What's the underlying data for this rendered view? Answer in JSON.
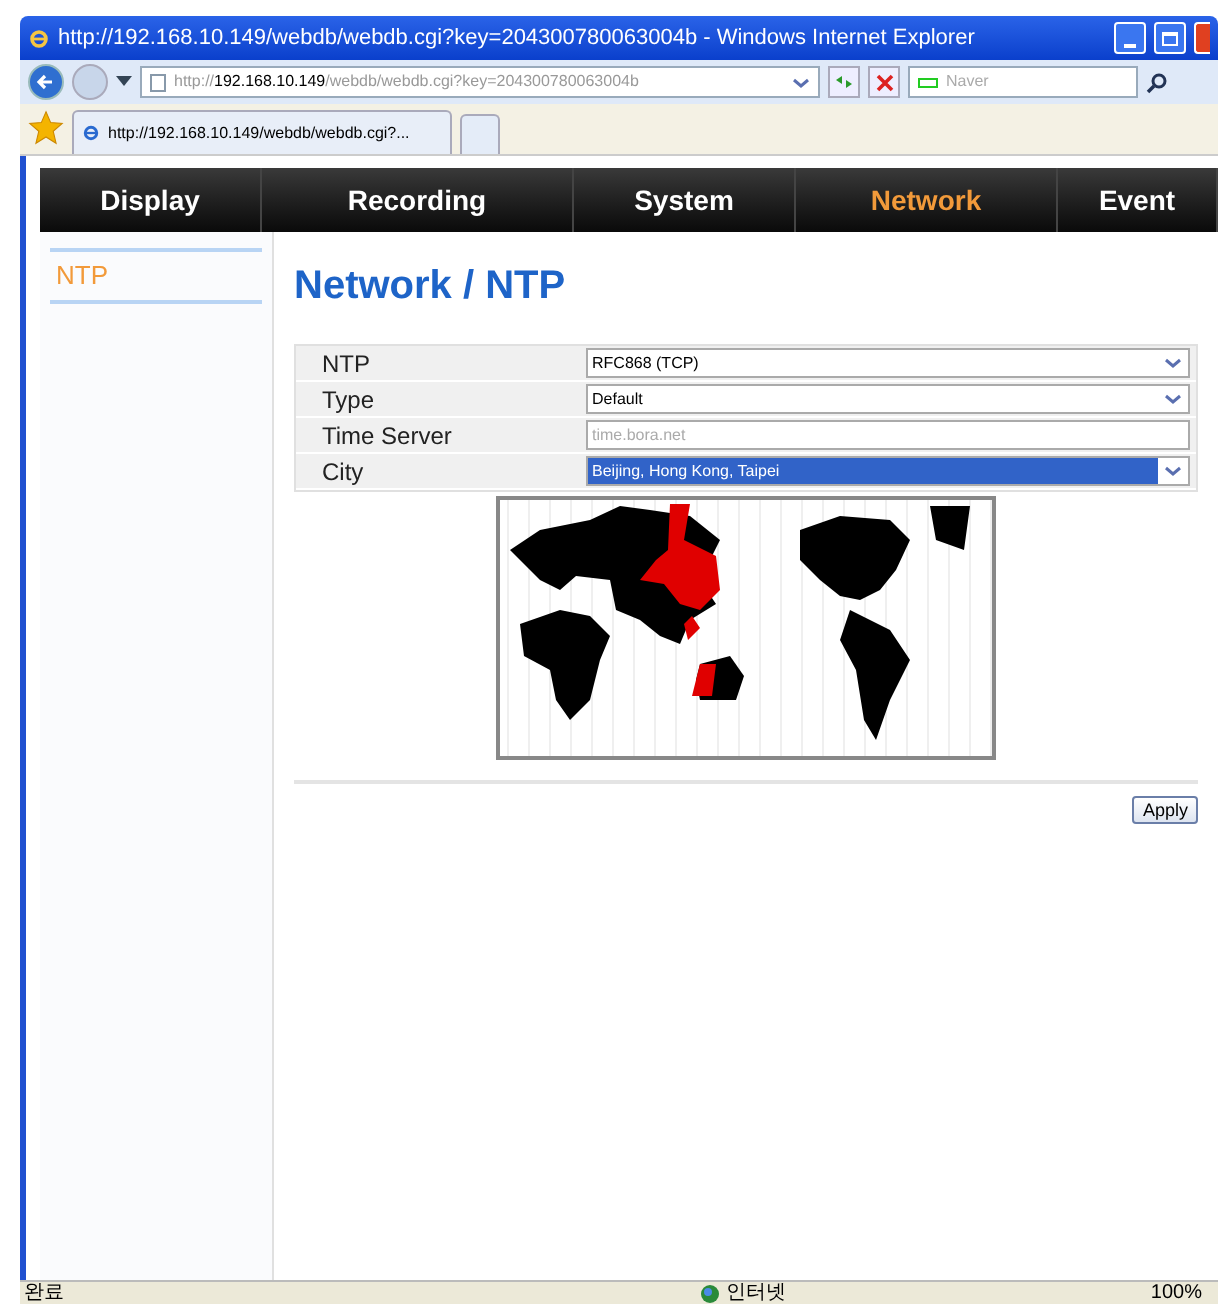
{
  "window": {
    "title": "http://192.168.10.149/webdb/webdb.cgi?key=204300780063004b - Windows Internet Explorer"
  },
  "address": {
    "scheme": "http://",
    "host": "192.168.10.149",
    "path": "/webdb/webdb.cgi?key=204300780063004b"
  },
  "search": {
    "placeholder": "Naver"
  },
  "browser_tab": {
    "title": "http://192.168.10.149/webdb/webdb.cgi?..."
  },
  "nav": [
    {
      "label": "Display",
      "selected": false
    },
    {
      "label": "Recording",
      "selected": false
    },
    {
      "label": "System",
      "selected": false
    },
    {
      "label": "Network",
      "selected": true
    },
    {
      "label": "Event",
      "selected": false
    }
  ],
  "sidebar": {
    "items": [
      {
        "label": "NTP",
        "selected": true
      }
    ]
  },
  "heading": "Network / NTP",
  "form": [
    {
      "label": "NTP",
      "kind": "select",
      "value": "RFC868 (TCP)",
      "focused": false
    },
    {
      "label": "Type",
      "kind": "select",
      "value": "Default",
      "focused": false
    },
    {
      "label": "Time Server",
      "kind": "text",
      "placeholder": "time.bora.net"
    },
    {
      "label": "City",
      "kind": "select",
      "value": "Beijing, Hong Kong, Taipei",
      "focused": true
    }
  ],
  "apply": "Apply",
  "status_bar": {
    "status": "완료",
    "zone": "인터넷",
    "zoom": "100%"
  }
}
